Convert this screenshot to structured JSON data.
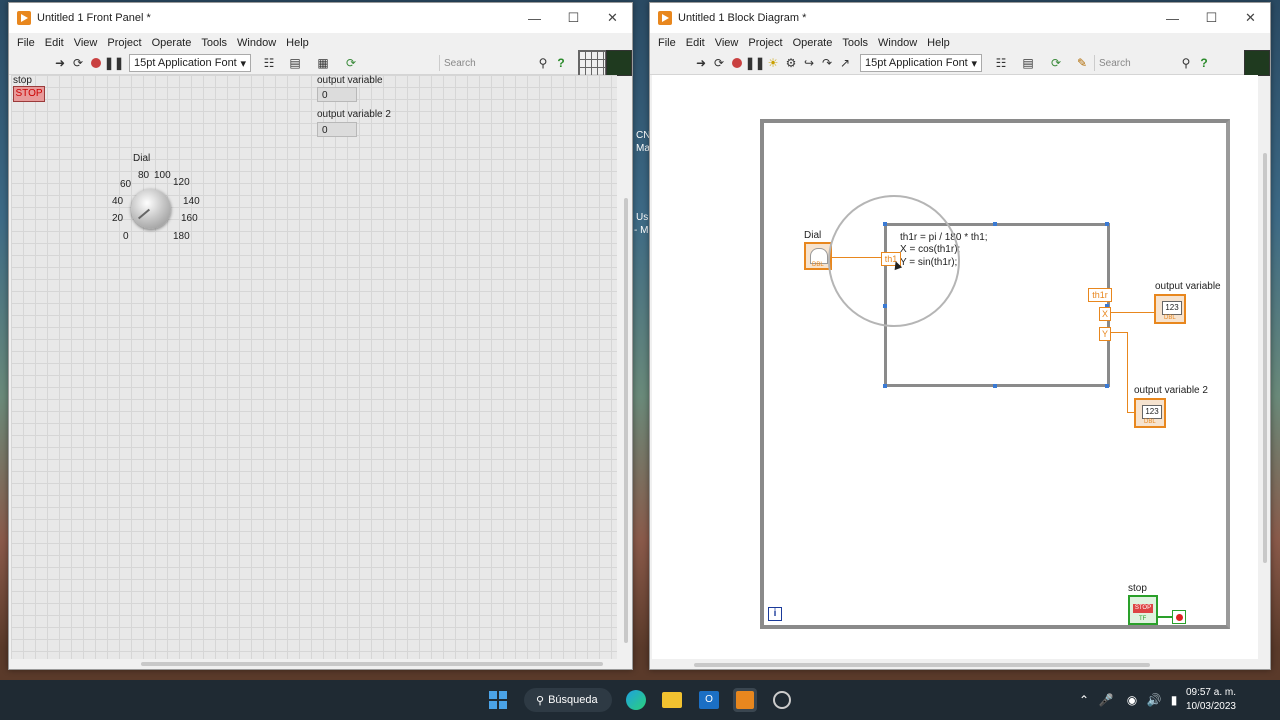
{
  "front_panel": {
    "title": "Untitled 1 Front Panel *",
    "menu": [
      "File",
      "Edit",
      "View",
      "Project",
      "Operate",
      "Tools",
      "Window",
      "Help"
    ],
    "font": "15pt Application Font",
    "search_placeholder": "Search",
    "stop_label": "stop",
    "stop_button": "STOP",
    "output1_label": "output variable",
    "output1_value": "0",
    "output2_label": "output variable 2",
    "output2_value": "0",
    "dial_label": "Dial",
    "dial_ticks": [
      "0",
      "20",
      "40",
      "60",
      "80",
      "100",
      "120",
      "140",
      "160",
      "180"
    ]
  },
  "block_diagram": {
    "title": "Untitled 1 Block Diagram *",
    "menu": [
      "File",
      "Edit",
      "View",
      "Project",
      "Operate",
      "Tools",
      "Window",
      "Help"
    ],
    "font": "15pt Application Font",
    "search_placeholder": "Search",
    "dial_label": "Dial",
    "formula": [
      "th1r = pi / 180 * th1;",
      "X = cos(th1r);",
      "Y = sin(th1r);"
    ],
    "input_terminal": "th1",
    "output_terminals": [
      "th1r",
      "X",
      "Y"
    ],
    "output1_label": "output variable",
    "output2_label": "output variable 2",
    "numeric_glyph": "123",
    "dbl_glyph": "DBL",
    "stop_label": "stop",
    "stop_glyph": "STOP",
    "tf_glyph": "TF",
    "loop_index": "i"
  },
  "taskbar": {
    "search_label": "Búsqueda",
    "time": "09:57 a. m.",
    "date": "10/03/2023"
  },
  "desktop_fragments": [
    "CN",
    "Ma",
    "Us",
    "- M"
  ]
}
